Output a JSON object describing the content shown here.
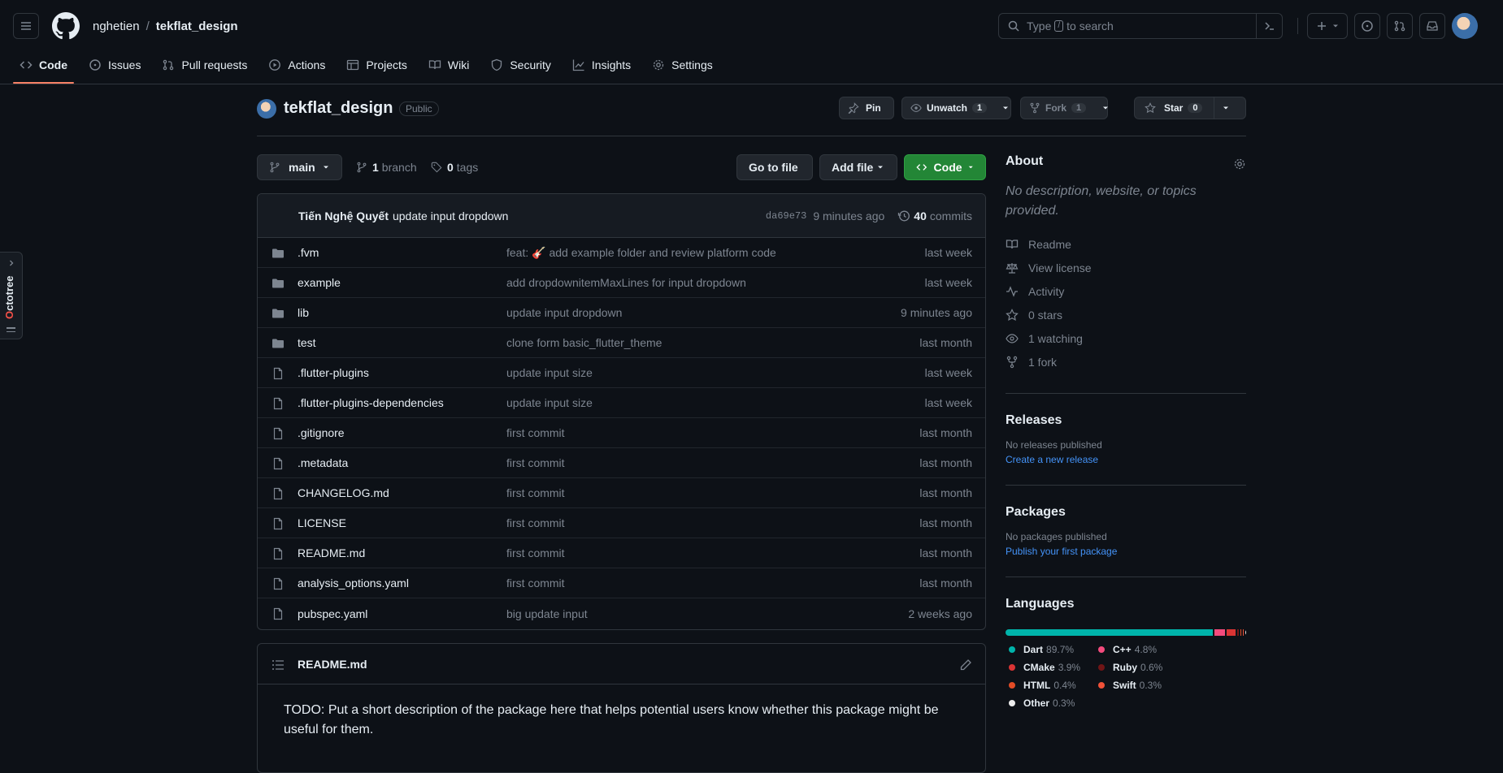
{
  "header": {
    "owner": "nghetien",
    "separator": "/",
    "repo": "tekflat_design",
    "search_prefix": "Type",
    "search_key": "/",
    "search_suffix": "to search"
  },
  "nav": {
    "tabs": [
      {
        "label": "Code",
        "icon": "code-icon",
        "active": true
      },
      {
        "label": "Issues",
        "icon": "issue-icon"
      },
      {
        "label": "Pull requests",
        "icon": "pull-request-icon"
      },
      {
        "label": "Actions",
        "icon": "play-icon"
      },
      {
        "label": "Projects",
        "icon": "table-icon"
      },
      {
        "label": "Wiki",
        "icon": "book-icon"
      },
      {
        "label": "Security",
        "icon": "shield-icon"
      },
      {
        "label": "Insights",
        "icon": "graph-icon"
      },
      {
        "label": "Settings",
        "icon": "gear-icon"
      }
    ]
  },
  "octotree": {
    "label_first": "O",
    "label_rest": "ctotree"
  },
  "title": {
    "repo": "tekflat_design",
    "visibility": "Public",
    "pin_label": "Pin",
    "unwatch_label": "Unwatch",
    "unwatch_count": "1",
    "fork_label": "Fork",
    "fork_count": "1",
    "star_label": "Star",
    "star_count": "0"
  },
  "branchbar": {
    "branch": "main",
    "branch_count": "1",
    "branch_word": "branch",
    "tag_count": "0",
    "tag_word": "tags",
    "go_to_file": "Go to file",
    "add_file": "Add file",
    "code": "Code"
  },
  "latest_commit": {
    "author": "Tiến Nghệ Quyết",
    "message": "update input dropdown",
    "sha": "da69e73",
    "age": "9 minutes ago",
    "commit_count": "40",
    "commit_word": "commits"
  },
  "files": [
    {
      "name": ".fvm",
      "type": "dir",
      "msg_prefix": "feat:",
      "msg_emoji": "🎸",
      "msg": "add example folder and review platform code",
      "age": "last week"
    },
    {
      "name": "example",
      "type": "dir",
      "msg_prefix": "",
      "msg_emoji": "",
      "msg": "add dropdownitemMaxLines for input dropdown",
      "age": "last week"
    },
    {
      "name": "lib",
      "type": "dir",
      "msg_prefix": "",
      "msg_emoji": "",
      "msg": "update input dropdown",
      "age": "9 minutes ago"
    },
    {
      "name": "test",
      "type": "dir",
      "msg_prefix": "",
      "msg_emoji": "",
      "msg": "clone form basic_flutter_theme",
      "age": "last month"
    },
    {
      "name": ".flutter-plugins",
      "type": "file",
      "msg_prefix": "",
      "msg_emoji": "",
      "msg": "update input size",
      "age": "last week"
    },
    {
      "name": ".flutter-plugins-dependencies",
      "type": "file",
      "msg_prefix": "",
      "msg_emoji": "",
      "msg": "update input size",
      "age": "last week"
    },
    {
      "name": ".gitignore",
      "type": "file",
      "msg_prefix": "",
      "msg_emoji": "",
      "msg": "first commit",
      "age": "last month"
    },
    {
      "name": ".metadata",
      "type": "file",
      "msg_prefix": "",
      "msg_emoji": "",
      "msg": "first commit",
      "age": "last month"
    },
    {
      "name": "CHANGELOG.md",
      "type": "file",
      "msg_prefix": "",
      "msg_emoji": "",
      "msg": "first commit",
      "age": "last month"
    },
    {
      "name": "LICENSE",
      "type": "file",
      "msg_prefix": "",
      "msg_emoji": "",
      "msg": "first commit",
      "age": "last month"
    },
    {
      "name": "README.md",
      "type": "file",
      "msg_prefix": "",
      "msg_emoji": "",
      "msg": "first commit",
      "age": "last month"
    },
    {
      "name": "analysis_options.yaml",
      "type": "file",
      "msg_prefix": "",
      "msg_emoji": "",
      "msg": "first commit",
      "age": "last month"
    },
    {
      "name": "pubspec.yaml",
      "type": "file",
      "msg_prefix": "",
      "msg_emoji": "",
      "msg": "big update input",
      "age": "2 weeks ago"
    }
  ],
  "readme": {
    "title": "README.md",
    "body": "TODO: Put a short description of the package here that helps potential users know whether this package might be useful for them."
  },
  "about": {
    "heading": "About",
    "description": "No description, website, or topics provided.",
    "links": [
      {
        "label": "Readme",
        "icon": "book-icon"
      },
      {
        "label": "View license",
        "icon": "law-icon"
      },
      {
        "label": "Activity",
        "icon": "pulse-icon"
      },
      {
        "label": "0 stars",
        "icon": "star-icon"
      },
      {
        "label": "1 watching",
        "icon": "eye-icon"
      },
      {
        "label": "1 fork",
        "icon": "fork-icon"
      }
    ]
  },
  "releases": {
    "heading": "Releases",
    "empty": "No releases published",
    "link": "Create a new release"
  },
  "packages": {
    "heading": "Packages",
    "empty": "No packages published",
    "link": "Publish your first package"
  },
  "languages": {
    "heading": "Languages",
    "items": [
      {
        "name": "Dart",
        "percent": "89.7%",
        "value": 89.7,
        "color": "#00B4AB"
      },
      {
        "name": "C++",
        "percent": "4.8%",
        "value": 4.8,
        "color": "#f34b7d"
      },
      {
        "name": "CMake",
        "percent": "3.9%",
        "value": 3.9,
        "color": "#DA3434"
      },
      {
        "name": "Ruby",
        "percent": "0.6%",
        "value": 0.6,
        "color": "#701516"
      },
      {
        "name": "HTML",
        "percent": "0.4%",
        "value": 0.4,
        "color": "#e34c26"
      },
      {
        "name": "Swift",
        "percent": "0.3%",
        "value": 0.3,
        "color": "#F05138"
      },
      {
        "name": "Other",
        "percent": "0.3%",
        "value": 0.3,
        "color": "#ededed"
      }
    ]
  }
}
